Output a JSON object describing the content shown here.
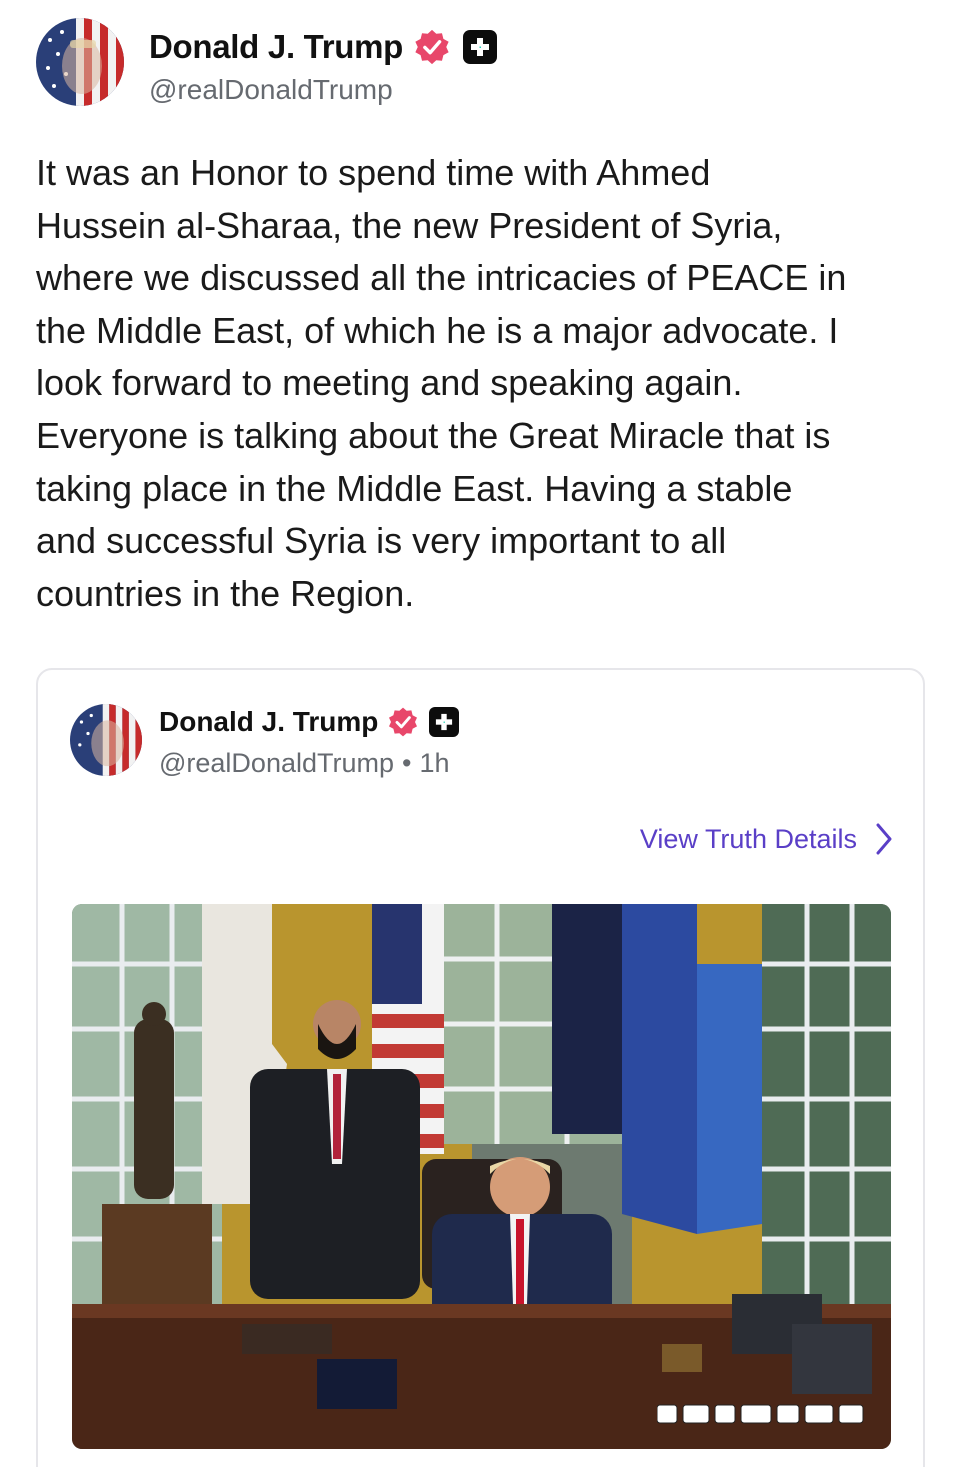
{
  "post": {
    "author_name": "Donald J. Trump",
    "handle": "@realDonaldTrump",
    "text": "It was an Honor to spend time with Ahmed\nHussein al-Sharaa, the new President of Syria,\nwhere we discussed all the intricacies of PEACE in\nthe Middle East, of which he is a major advocate. I\nlook forward to meeting and speaking again.\nEveryone is talking about the Great Miracle that is\ntaking place in the Middle East. Having a stable\nand successful Syria is very important to all\ncountries in the Region."
  },
  "quoted": {
    "author_name": "Donald J. Trump",
    "handle": "@realDonaldTrump",
    "separator": "•",
    "time": "1h",
    "view_details_label": "View Truth Details"
  },
  "colors": {
    "verified_badge": "#e8476a",
    "link": "#5a3fc7",
    "handle_gray": "#666a70"
  },
  "icons": [
    "verified-badge-icon",
    "plus-badge-icon",
    "chevron-right-icon"
  ]
}
